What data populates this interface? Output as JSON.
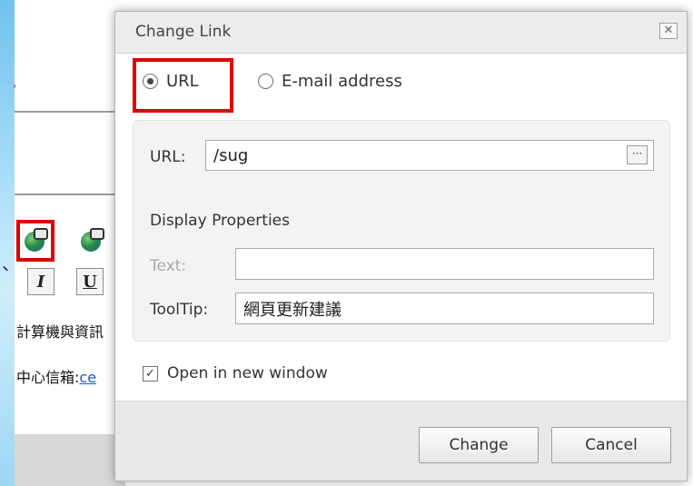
{
  "background": {
    "arrow_glyph": "›",
    "comma_glyph": "、",
    "toolbar": {
      "link_icon": "link-globe-icon",
      "unlink_icon": "unlink-globe-icon",
      "italic_label": "I",
      "underline_label": "U"
    },
    "text_line1": "計算機與資訊",
    "text_line2_prefix": "中心信箱:",
    "text_line2_link": "ce",
    "highlight_color": "#e00000"
  },
  "dialog": {
    "title": "Change Link",
    "close_label": "✕",
    "link_type": {
      "options": [
        {
          "label": "URL",
          "selected": true
        },
        {
          "label": "E-mail address",
          "selected": false
        }
      ]
    },
    "url": {
      "label": "URL:",
      "value": "/sug",
      "browse_label": "···"
    },
    "display_properties": {
      "heading": "Display Properties",
      "text_label": "Text:",
      "text_value": "",
      "tooltip_label": "ToolTip:",
      "tooltip_value": "網頁更新建議"
    },
    "open_in_new_window": {
      "label": "Open in new window",
      "checked": true,
      "check_glyph": "✓"
    },
    "buttons": {
      "change": "Change",
      "cancel": "Cancel"
    }
  }
}
